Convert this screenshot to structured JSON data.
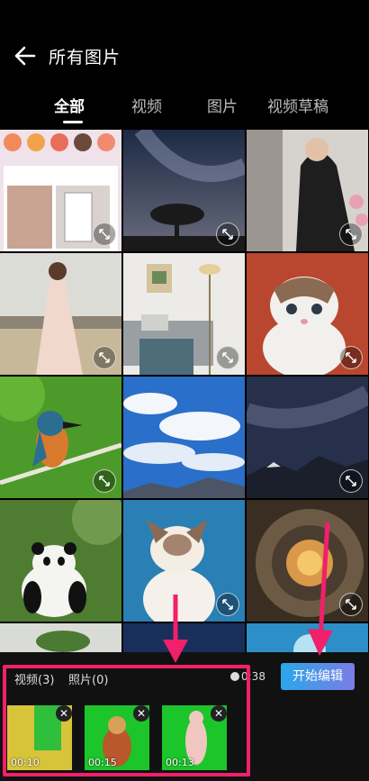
{
  "header": {
    "title": "所有图片",
    "back_icon": "back-arrow-icon"
  },
  "tabs": [
    {
      "label": "全部",
      "active": true
    },
    {
      "label": "视频",
      "active": false
    },
    {
      "label": "图片",
      "active": false
    },
    {
      "label": "视频草稿",
      "active": false
    }
  ],
  "grid": {
    "items": [
      {
        "kind": "screenshot"
      },
      {
        "kind": "night-sky-tree"
      },
      {
        "kind": "woman-dark-coat"
      },
      {
        "kind": "woman-dress"
      },
      {
        "kind": "room-interior"
      },
      {
        "kind": "kitten"
      },
      {
        "kind": "kingfisher"
      },
      {
        "kind": "blue-sky-clouds"
      },
      {
        "kind": "starry-mountains"
      },
      {
        "kind": "panda"
      },
      {
        "kind": "ragdoll-cat"
      },
      {
        "kind": "spiral-stairs"
      }
    ]
  },
  "bottom": {
    "video_count": "视频(3)",
    "photo_count": "照片(0)",
    "total_duration": "0:38",
    "edit_button": "开始编辑",
    "clips": [
      {
        "duration": "00:10",
        "close": "✕"
      },
      {
        "duration": "00:15",
        "close": "✕"
      },
      {
        "duration": "00:13",
        "close": "✕"
      }
    ]
  },
  "annotation_color": "#f0206a"
}
